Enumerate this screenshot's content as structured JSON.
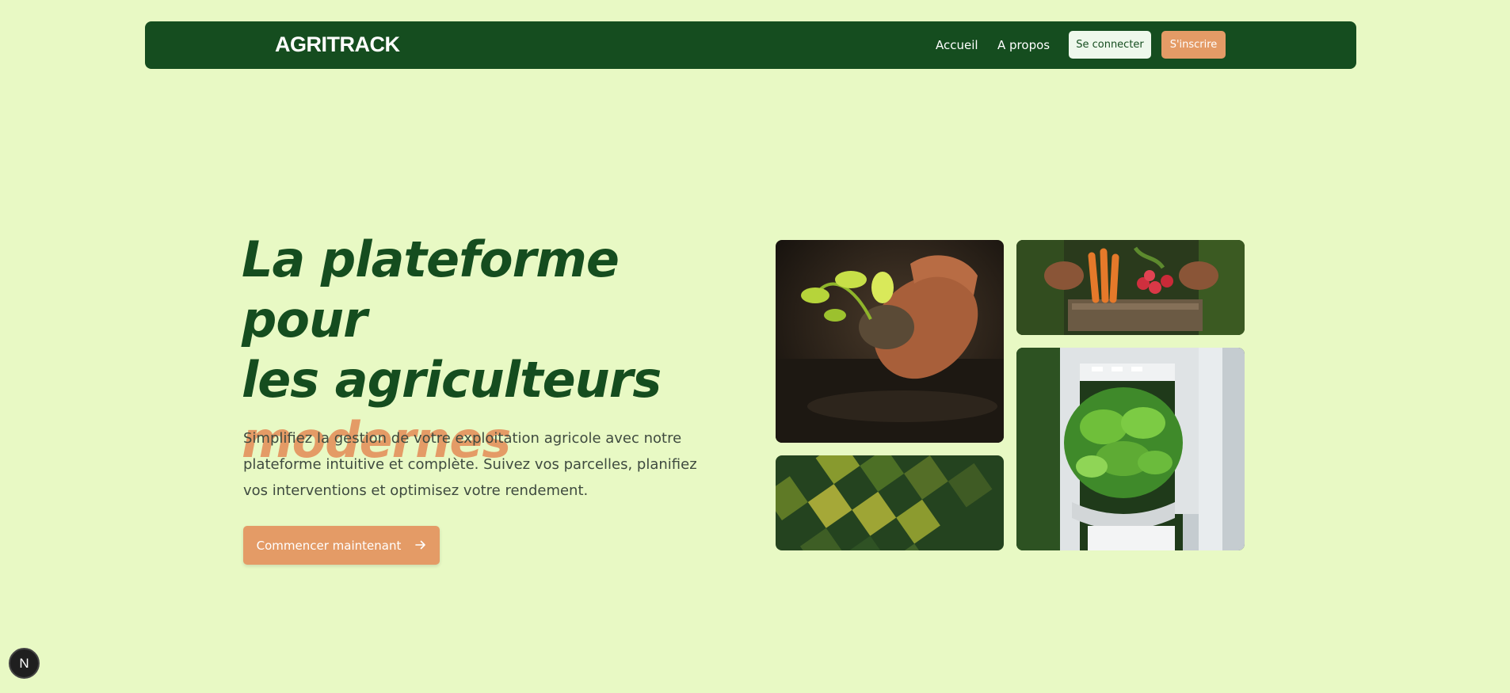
{
  "nav": {
    "brand": "AGRITRACK",
    "links": [
      {
        "label": "Accueil"
      },
      {
        "label": "A propos"
      }
    ],
    "login_label": "Se connecter",
    "signup_label": "S'inscrire"
  },
  "hero": {
    "title_line1": "La plateforme pour",
    "title_line2": "les agriculteurs",
    "title_accent": "modernes",
    "description": "Simplifiez la gestion de votre exploitation agricole avec notre plateforme intuitive et complète. Suivez vos parcelles, planifiez vos interventions et optimisez votre rendement.",
    "cta_label": "Commencer maintenant",
    "cta_icon": "arrow-right-icon"
  },
  "images": [
    {
      "name": "hands-planting-seedling-image"
    },
    {
      "name": "harvested-vegetables-crate-image"
    },
    {
      "name": "aerial-fields-image"
    },
    {
      "name": "hydroponic-plant-tower-image"
    }
  ],
  "badge": {
    "label": "N"
  },
  "colors": {
    "background": "#e8f9c4",
    "primary": "#154d1f",
    "accent": "#e49b66"
  }
}
